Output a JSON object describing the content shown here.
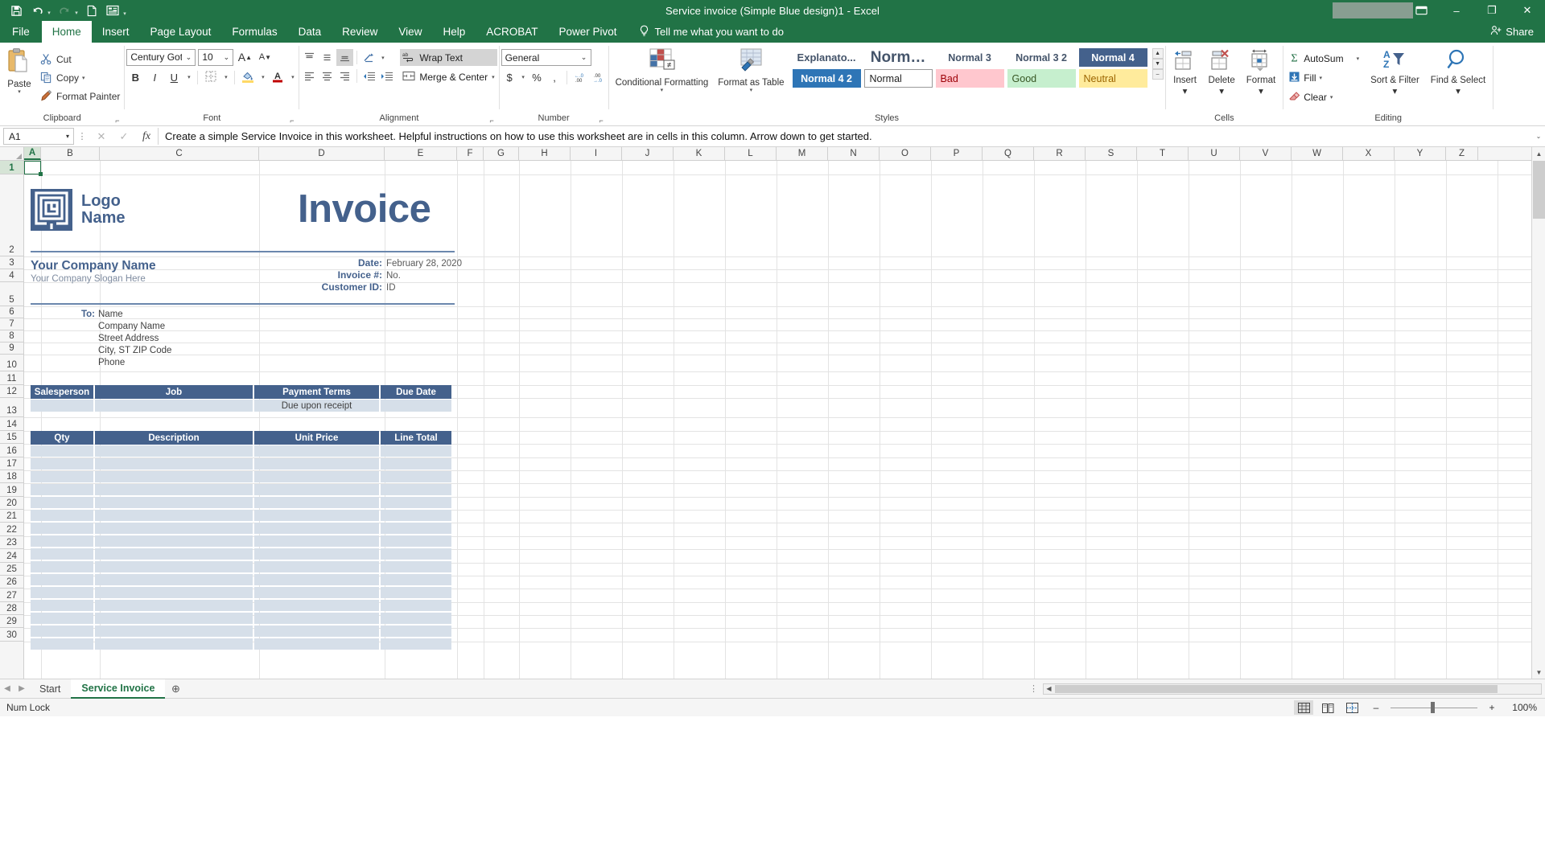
{
  "titlebar": {
    "document_title": "Service invoice (Simple Blue design)1  -  Excel",
    "quick_access": [
      {
        "name": "save-icon",
        "label": "Save"
      },
      {
        "name": "undo-icon",
        "label": "Undo"
      },
      {
        "name": "redo-icon",
        "label": "Redo"
      },
      {
        "name": "new-icon",
        "label": "New"
      },
      {
        "name": "touch-mode-icon",
        "label": "Touch/Mouse Mode"
      },
      {
        "name": "customize-qat-icon",
        "label": "Customize Quick Access Toolbar"
      }
    ],
    "ribbon_display_label": "⬆",
    "minimize_label": "–",
    "restore_label": "❐",
    "close_label": "✕"
  },
  "tabs": {
    "items": [
      {
        "label": "File",
        "active": false
      },
      {
        "label": "Home",
        "active": true
      },
      {
        "label": "Insert",
        "active": false
      },
      {
        "label": "Page Layout",
        "active": false
      },
      {
        "label": "Formulas",
        "active": false
      },
      {
        "label": "Data",
        "active": false
      },
      {
        "label": "Review",
        "active": false
      },
      {
        "label": "View",
        "active": false
      },
      {
        "label": "Help",
        "active": false
      },
      {
        "label": "ACROBAT",
        "active": false
      },
      {
        "label": "Power Pivot",
        "active": false
      }
    ],
    "tell_me": "Tell me what you want to do",
    "share": "Share"
  },
  "ribbon": {
    "clipboard": {
      "group_label": "Clipboard",
      "paste_label": "Paste",
      "cut_label": "Cut",
      "copy_label": "Copy",
      "format_painter_label": "Format Painter"
    },
    "font": {
      "group_label": "Font",
      "font_name": "Century Gothic",
      "font_size": "10",
      "grow_font_label": "A",
      "shrink_font_label": "A",
      "bold_label": "B",
      "italic_label": "I",
      "underline_label": "U"
    },
    "alignment": {
      "group_label": "Alignment",
      "wrap_text_label": "Wrap Text",
      "merge_center_label": "Merge & Center"
    },
    "number": {
      "group_label": "Number",
      "format_value": "General",
      "currency_label": "$",
      "percent_label": "%",
      "comma_label": ",",
      "decrease_decimal_label": "←.0",
      "increase_decimal_label": ".00"
    },
    "styles": {
      "group_label": "Styles",
      "conditional_formatting_label": "Conditional Formatting",
      "format_as_table_label": "Format as Table",
      "gallery_row1": [
        {
          "label": "Explanato...",
          "kind": "expl"
        },
        {
          "label": "Norm…",
          "kind": "normbig"
        },
        {
          "label": "Normal 3",
          "kind": "norm3"
        },
        {
          "label": "Normal 3 2",
          "kind": "norm3"
        },
        {
          "label": "Normal 4",
          "kind": "norm4"
        }
      ],
      "gallery_row2": [
        {
          "label": "Normal 4 2",
          "kind": "n42"
        },
        {
          "label": "Normal",
          "kind": "normal"
        },
        {
          "label": "Bad",
          "kind": "bad"
        },
        {
          "label": "Good",
          "kind": "good"
        },
        {
          "label": "Neutral",
          "kind": "neutral"
        }
      ],
      "scroll_up": "▲",
      "scroll_down": "▼",
      "scroll_more": "–"
    },
    "cells": {
      "group_label": "Cells",
      "insert_label": "Insert",
      "delete_label": "Delete",
      "format_label": "Format"
    },
    "editing": {
      "group_label": "Editing",
      "autosum_label": "AutoSum",
      "fill_label": "Fill",
      "clear_label": "Clear",
      "sort_filter_label": "Sort & Filter",
      "find_select_label": "Find & Select"
    }
  },
  "formula_bar": {
    "name_box_value": "A1",
    "cancel_label": "✕",
    "enter_label": "✓",
    "insert_function_label": "fx",
    "formula_value": "Create a simple Service Invoice in this worksheet. Helpful instructions on how to use this worksheet are in cells in this column. Arrow down to get started."
  },
  "grid": {
    "selected_cell": "A1",
    "column_headers": [
      "A",
      "B",
      "C",
      "D",
      "E",
      "F",
      "G",
      "H",
      "I",
      "J",
      "K",
      "L",
      "M",
      "N",
      "O",
      "P",
      "Q",
      "R",
      "S",
      "T",
      "U",
      "V",
      "W",
      "X",
      "Y",
      "Z"
    ],
    "row_headers": [
      "1",
      "2",
      "3",
      "4",
      "5",
      "6",
      "7",
      "8",
      "9",
      "10",
      "11",
      "12",
      "13",
      "14",
      "15",
      "16",
      "17",
      "18",
      "19",
      "20",
      "21",
      "22",
      "23",
      "24",
      "25",
      "26",
      "27",
      "28",
      "29",
      "30"
    ]
  },
  "invoice": {
    "logo_line1": "Logo",
    "logo_line2": "Name",
    "title": "Invoice",
    "company_name": "Your Company Name",
    "company_slogan": "Your Company Slogan Here",
    "meta": [
      {
        "label": "Date:",
        "value": "February 28, 2020"
      },
      {
        "label": "Invoice #:",
        "value": "No."
      },
      {
        "label": "Customer ID:",
        "value": "ID"
      }
    ],
    "to_label": "To:",
    "to_lines": [
      "Name",
      "Company Name",
      "Street Address",
      "City, ST  ZIP Code",
      "Phone"
    ],
    "job_table": {
      "headers": [
        "Salesperson",
        "Job",
        "Payment Terms",
        "Due Date"
      ],
      "row": [
        "",
        "",
        "Due upon receipt",
        ""
      ]
    },
    "line_table": {
      "headers": [
        "Qty",
        "Description",
        "Unit Price",
        "Line Total"
      ],
      "empty_row_count": 16
    },
    "accent_color": "#44618c",
    "row_fill_color": "#d6dfe9",
    "rule_color": "#6b87ad"
  },
  "sheet_tabs": {
    "prev_label": "◀",
    "next_label": "▶",
    "items": [
      {
        "label": "Start",
        "active": false
      },
      {
        "label": "Service Invoice",
        "active": true
      }
    ],
    "add_sheet_label": "⊕"
  },
  "status_bar": {
    "left_text": "Num Lock",
    "views": [
      {
        "name": "normal-view-icon",
        "selected": true
      },
      {
        "name": "page-layout-view-icon",
        "selected": false
      },
      {
        "name": "page-break-preview-icon",
        "selected": false
      }
    ],
    "zoom_out_label": "–",
    "zoom_in_label": "+",
    "zoom_value": "100%"
  }
}
